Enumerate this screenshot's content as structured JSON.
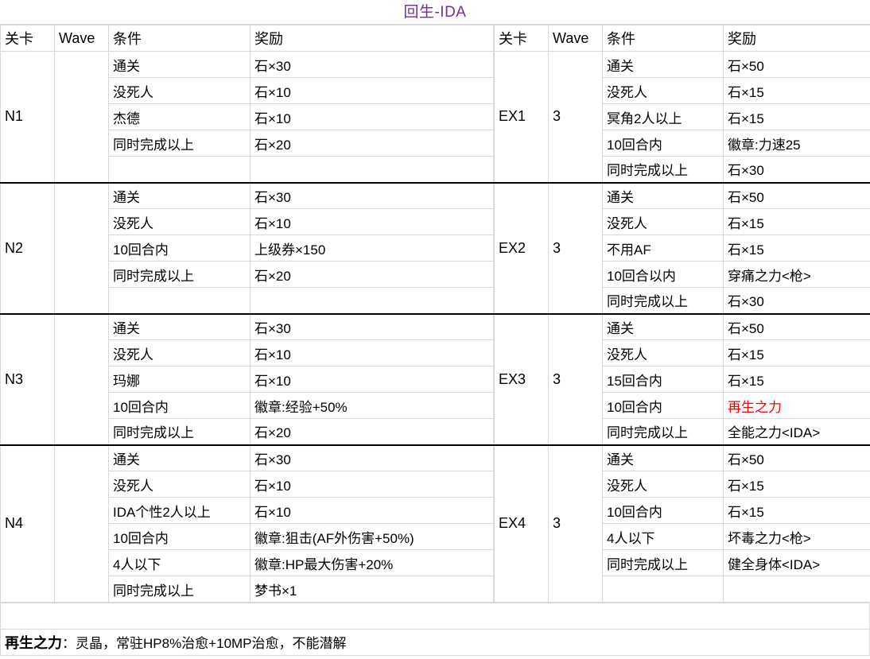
{
  "title": "回生-IDA",
  "title_color": "#7030a0",
  "headers": {
    "stage": "关卡",
    "wave": "Wave",
    "condition": "条件",
    "reward": "奖励"
  },
  "left_table": {
    "blocks": [
      {
        "stage": "N1",
        "wave": "",
        "rows": [
          {
            "condition": "通关",
            "reward": "石×30",
            "bold": false,
            "red": false
          },
          {
            "condition": "没死人",
            "reward": "石×10",
            "bold": false,
            "red": false
          },
          {
            "condition": "杰德",
            "reward": "石×10",
            "bold": false,
            "red": false
          },
          {
            "condition": "同时完成以上",
            "reward": "石×20",
            "bold": false,
            "red": false
          },
          {
            "condition": "",
            "reward": "",
            "bold": false,
            "red": false
          }
        ]
      },
      {
        "stage": "N2",
        "wave": "",
        "rows": [
          {
            "condition": "通关",
            "reward": "石×30",
            "bold": false,
            "red": false
          },
          {
            "condition": "没死人",
            "reward": "石×10",
            "bold": false,
            "red": false
          },
          {
            "condition": "10回合内",
            "reward": "上级券×150",
            "bold": false,
            "red": false
          },
          {
            "condition": "同时完成以上",
            "reward": "石×20",
            "bold": false,
            "red": false
          },
          {
            "condition": "",
            "reward": "",
            "bold": false,
            "red": false
          }
        ]
      },
      {
        "stage": "N3",
        "wave": "",
        "rows": [
          {
            "condition": "通关",
            "reward": "石×30",
            "bold": false,
            "red": false
          },
          {
            "condition": "没死人",
            "reward": "石×10",
            "bold": false,
            "red": false
          },
          {
            "condition": "玛娜",
            "reward": "石×10",
            "bold": false,
            "red": false
          },
          {
            "condition": "10回合内",
            "reward": "徽章:经验+50%",
            "bold": true,
            "red": false
          },
          {
            "condition": "同时完成以上",
            "reward": "石×20",
            "bold": false,
            "red": false
          }
        ]
      },
      {
        "stage": "N4",
        "wave": "",
        "rows": [
          {
            "condition": "通关",
            "reward": "石×30",
            "bold": false,
            "red": false
          },
          {
            "condition": "没死人",
            "reward": "石×10",
            "bold": false,
            "red": false
          },
          {
            "condition": "IDA个性2人以上",
            "reward": "石×10",
            "bold": false,
            "red": false
          },
          {
            "condition": "10回合内",
            "reward": "徽章:狙击(AF外伤害+50%)",
            "bold": true,
            "red": false
          },
          {
            "condition": "4人以下",
            "reward": "徽章:HP最大伤害+20%",
            "bold": true,
            "red": false
          },
          {
            "condition": "同时完成以上",
            "reward": "梦书×1",
            "bold": false,
            "red": false
          }
        ]
      }
    ]
  },
  "right_table": {
    "blocks": [
      {
        "stage": "EX1",
        "wave": "3",
        "rows": [
          {
            "condition": "通关",
            "reward": "石×50",
            "bold": false,
            "red": false
          },
          {
            "condition": "没死人",
            "reward": "石×15",
            "bold": false,
            "red": false
          },
          {
            "condition": "冥角2人以上",
            "reward": "石×15",
            "bold": false,
            "red": false
          },
          {
            "condition": "10回合内",
            "reward": "徽章:力速25",
            "bold": true,
            "red": false
          },
          {
            "condition": "同时完成以上",
            "reward": "石×30",
            "bold": false,
            "red": false
          }
        ]
      },
      {
        "stage": "EX2",
        "wave": "3",
        "rows": [
          {
            "condition": "通关",
            "reward": "石×50",
            "bold": false,
            "red": false
          },
          {
            "condition": "没死人",
            "reward": "石×15",
            "bold": false,
            "red": false
          },
          {
            "condition": "不用AF",
            "reward": "石×15",
            "bold": false,
            "red": false
          },
          {
            "condition": "10回合以内",
            "reward": "穿痛之力<枪>",
            "bold": true,
            "red": false
          },
          {
            "condition": "同时完成以上",
            "reward": "石×30",
            "bold": false,
            "red": false
          }
        ]
      },
      {
        "stage": "EX3",
        "wave": "3",
        "rows": [
          {
            "condition": "通关",
            "reward": "石×50",
            "bold": false,
            "red": false
          },
          {
            "condition": "没死人",
            "reward": "石×15",
            "bold": false,
            "red": false
          },
          {
            "condition": "15回合内",
            "reward": "石×15",
            "bold": false,
            "red": false
          },
          {
            "condition": "10回合内",
            "reward": "再生之力",
            "bold": false,
            "red": true
          },
          {
            "condition": "同时完成以上",
            "reward": "全能之力<IDA>",
            "bold": true,
            "red": false
          }
        ]
      },
      {
        "stage": "EX4",
        "wave": "3",
        "rows": [
          {
            "condition": "通关",
            "reward": "石×50",
            "bold": false,
            "red": false
          },
          {
            "condition": "没死人",
            "reward": "石×15",
            "bold": false,
            "red": false
          },
          {
            "condition": "10回合内",
            "reward": "石×15",
            "bold": false,
            "red": false
          },
          {
            "condition": "4人以下",
            "reward": "坏毒之力<枪>",
            "bold": true,
            "red": false
          },
          {
            "condition": "同时完成以上",
            "reward": "健全身体<IDA>",
            "bold": true,
            "red": false
          },
          {
            "condition": "",
            "reward": "",
            "bold": false,
            "red": false
          }
        ]
      }
    ]
  },
  "footer": {
    "note_head": "再生之力",
    "note_body": "：灵晶，常驻HP8%治愈+10MP治愈，不能潜解"
  }
}
